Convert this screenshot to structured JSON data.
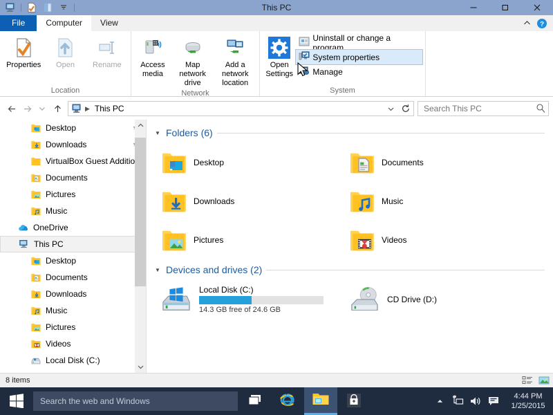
{
  "window": {
    "title": "This PC",
    "quick_access": [
      "this-pc-icon",
      "properties-icon",
      "layout-icon",
      "dropdown-icon"
    ],
    "controls": {
      "minimize": "–",
      "restore": "❐",
      "close": "✕"
    }
  },
  "ribbon": {
    "tabs": [
      {
        "label": "File",
        "state": "file"
      },
      {
        "label": "Computer",
        "state": "active"
      },
      {
        "label": "View",
        "state": "inactive"
      }
    ],
    "collapse_icon": "chevron-up-icon",
    "help_icon": "help-icon",
    "groups": [
      {
        "title": "Location",
        "buttons": [
          {
            "label": "Properties",
            "icon": "properties-icon",
            "disabled": false
          },
          {
            "label": "Open",
            "icon": "open-icon",
            "disabled": true
          },
          {
            "label": "Rename",
            "icon": "rename-icon",
            "disabled": true
          }
        ]
      },
      {
        "title": "Network",
        "buttons": [
          {
            "label": "Access media",
            "icon": "access-media-icon",
            "split": true
          },
          {
            "label": "Map network drive",
            "icon": "map-drive-icon",
            "split": true
          },
          {
            "label": "Add a network location",
            "icon": "add-network-icon",
            "split": false
          }
        ]
      },
      {
        "title": "System",
        "big_button": {
          "label": "Open Settings",
          "icon": "settings-gear-icon"
        },
        "small_buttons": [
          {
            "label": "Uninstall or change a program",
            "icon": "uninstall-icon",
            "hovered": false
          },
          {
            "label": "System properties",
            "icon": "system-properties-icon",
            "hovered": true
          },
          {
            "label": "Manage",
            "icon": "manage-icon",
            "hovered": false
          }
        ]
      }
    ]
  },
  "addressbar": {
    "back_icon": "arrow-left-icon",
    "forward_icon": "arrow-right-icon",
    "recent_icon": "chevron-down-icon",
    "up_icon": "arrow-up-icon",
    "crumb_icon": "this-pc-icon",
    "crumb_label": "This PC",
    "dropdown_icon": "chevron-down-icon",
    "refresh_icon": "refresh-icon",
    "search_placeholder": "Search This PC",
    "search_value": "",
    "search_icon": "search-icon"
  },
  "navpane": {
    "items": [
      {
        "label": "Desktop",
        "icon": "folder-desktop-icon",
        "indent": 2,
        "pinned": true
      },
      {
        "label": "Downloads",
        "icon": "folder-downloads-icon",
        "indent": 2,
        "pinned": true
      },
      {
        "label": "VirtualBox Guest Additions",
        "icon": "folder-icon",
        "indent": 2,
        "pinned": false
      },
      {
        "label": "Documents",
        "icon": "folder-documents-icon",
        "indent": 2,
        "pinned": false
      },
      {
        "label": "Pictures",
        "icon": "folder-pictures-icon",
        "indent": 2,
        "pinned": false
      },
      {
        "label": "Music",
        "icon": "folder-music-icon",
        "indent": 2,
        "pinned": false
      },
      {
        "label": "OneDrive",
        "icon": "onedrive-icon",
        "indent": 1,
        "pinned": false
      },
      {
        "label": "This PC",
        "icon": "this-pc-icon",
        "indent": 1,
        "pinned": false,
        "selected": true
      },
      {
        "label": "Desktop",
        "icon": "folder-desktop-icon",
        "indent": 2,
        "pinned": false
      },
      {
        "label": "Documents",
        "icon": "folder-documents-icon",
        "indent": 2,
        "pinned": false
      },
      {
        "label": "Downloads",
        "icon": "folder-downloads-icon",
        "indent": 2,
        "pinned": false
      },
      {
        "label": "Music",
        "icon": "folder-music-icon",
        "indent": 2,
        "pinned": false
      },
      {
        "label": "Pictures",
        "icon": "folder-pictures-icon",
        "indent": 2,
        "pinned": false
      },
      {
        "label": "Videos",
        "icon": "folder-videos-icon",
        "indent": 2,
        "pinned": false
      },
      {
        "label": "Local Disk (C:)",
        "icon": "drive-icon",
        "indent": 2,
        "pinned": false
      }
    ],
    "scroll_up_icon": "chevron-up-icon",
    "scroll_down_icon": "chevron-down-icon"
  },
  "main": {
    "folders_section": {
      "title": "Folders (6)",
      "collapse_icon": "chevron-down-icon",
      "items": [
        {
          "label": "Desktop",
          "icon": "folder-desktop-icon"
        },
        {
          "label": "Documents",
          "icon": "folder-documents-icon"
        },
        {
          "label": "Downloads",
          "icon": "folder-downloads-icon"
        },
        {
          "label": "Music",
          "icon": "folder-music-icon"
        },
        {
          "label": "Pictures",
          "icon": "folder-pictures-icon"
        },
        {
          "label": "Videos",
          "icon": "folder-videos-icon"
        }
      ]
    },
    "drives_section": {
      "title": "Devices and drives (2)",
      "collapse_icon": "chevron-down-icon",
      "items": [
        {
          "label": "Local Disk (C:)",
          "icon": "local-disk-icon",
          "has_bar": true,
          "used_percent": 42,
          "capacity_text": "14.3 GB free of 24.6 GB",
          "bar_color": "#26a0da"
        },
        {
          "label": "CD Drive (D:)",
          "icon": "cd-drive-icon",
          "has_bar": false,
          "used_percent": 0,
          "capacity_text": "",
          "bar_color": ""
        }
      ]
    }
  },
  "statusbar": {
    "item_count": "8 items",
    "view_buttons": [
      {
        "name": "details-view-button",
        "icon": "details-view-icon"
      },
      {
        "name": "large-icons-view-button",
        "icon": "large-icons-view-icon"
      }
    ]
  },
  "taskbar": {
    "start_icon": "windows-logo-icon",
    "search_placeholder": "Search the web and Windows",
    "search_value": "",
    "buttons": [
      {
        "name": "task-view-button",
        "icon": "task-view-icon",
        "active": false
      },
      {
        "name": "internet-explorer-button",
        "icon": "internet-explorer-icon",
        "active": false
      },
      {
        "name": "file-explorer-button",
        "icon": "file-explorer-icon",
        "active": true
      },
      {
        "name": "store-button",
        "icon": "store-icon",
        "active": false
      }
    ],
    "tray": [
      {
        "name": "show-hidden-icons-button",
        "icon": "chevron-up-icon"
      },
      {
        "name": "network-icon",
        "icon": "network-icon"
      },
      {
        "name": "volume-icon",
        "icon": "volume-icon"
      },
      {
        "name": "action-center-icon",
        "icon": "action-center-icon"
      }
    ],
    "clock": {
      "time": "4:44 PM",
      "date": "1/25/2015"
    }
  },
  "colors": {
    "titlebar": "#8ba4ce",
    "file_tab": "#0c5fb3",
    "section_title": "#1b5b9e",
    "accent": "#26a0da",
    "taskbar": "#1f2b3e"
  }
}
